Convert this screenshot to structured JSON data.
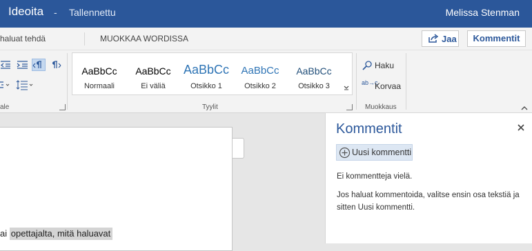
{
  "titlebar": {
    "doc_name": "Ideoita",
    "separator": "-",
    "save_status": "Tallennettu",
    "user_name": "Melissa Stenman"
  },
  "tabbar": {
    "tell_me": "haluat tehdä",
    "edit_in_word": "MUOKKAA WORDISSA",
    "share_label": "Jaa",
    "comments_label": "Kommentit"
  },
  "ribbon": {
    "paragraph_group_label": "ale",
    "styles_group_label": "Tyylit",
    "editing_group_label": "Muokkaus",
    "styles": [
      {
        "preview": "AaBbCc",
        "name": "Normaali",
        "color": "#000000"
      },
      {
        "preview": "AaBbCc",
        "name": "Ei väliä",
        "color": "#000000"
      },
      {
        "preview": "AaBbCc",
        "name": "Otsikko 1",
        "color": "#2e74b5"
      },
      {
        "preview": "AaBbCc",
        "name": "Otsikko 2",
        "color": "#2e74b5"
      },
      {
        "preview": "AaBbCc",
        "name": "Otsikko 3",
        "color": "#1f4d78"
      }
    ],
    "find_label": "Haku",
    "replace_label": "Korvaa",
    "replace_icon_text": "ab→c"
  },
  "document": {
    "line_prefix": "ai ",
    "line_highlighted": "opettajalta, mitä haluavat"
  },
  "comments_pane": {
    "title": "Kommentit",
    "new_comment_label": "Uusi kommentti",
    "empty_text": "Ei kommentteja vielä.",
    "hint_text": "Jos haluat kommentoida, valitse ensin osa tekstiä ja sitten Uusi kommentti."
  },
  "colors": {
    "brand": "#2b579a",
    "accent": "#2e74b5"
  }
}
